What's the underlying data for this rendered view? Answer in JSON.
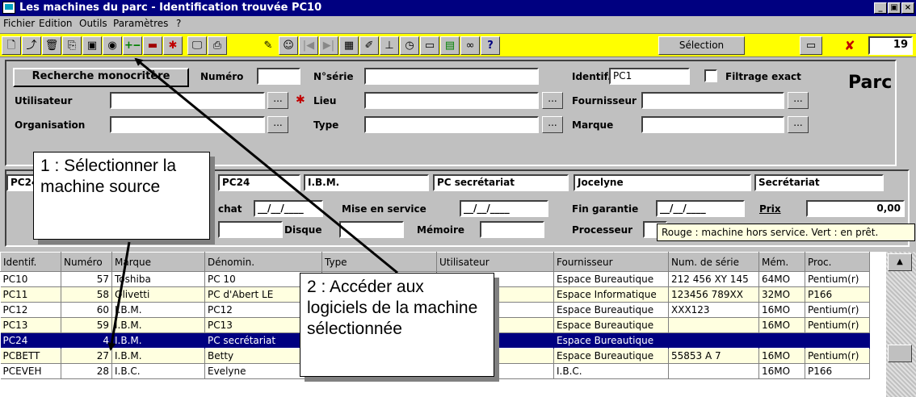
{
  "window": {
    "title": "Les machines du parc - Identification trouvée PC10",
    "controls": [
      "_",
      "ȸ",
      "×"
    ]
  },
  "menu": [
    "Fichier",
    "Edition",
    "Outils",
    "Paramètres",
    "?"
  ],
  "toolbar": {
    "selection_label": "Sélection",
    "count_value": "19"
  },
  "search": {
    "mode_button": "Recherche monocritère",
    "numero_label": "Numéro",
    "numero_value": "",
    "nserie_label": "N°série",
    "nserie_value": "",
    "identif_label": "Identif.",
    "identif_value": "PC1",
    "filtrage_label": "Filtrage exact",
    "utilisateur_label": "Utilisateur",
    "lieu_label": "Lieu",
    "fournisseur_label": "Fournisseur",
    "organisation_label": "Organisation",
    "type_label": "Type",
    "marque_label": "Marque",
    "dots": "...",
    "panel_title": "Parc"
  },
  "detail": {
    "identif_value": "PC24",
    "marque_value": "I.B.M.",
    "denomination_value": "PC secrétariat",
    "utilisateur_value": "Jocelyne",
    "organisation_value": "Secrétariat",
    "achat_label": "chat",
    "achat_value": "__/__/____",
    "mise_label": "Mise en service",
    "mise_value": "__/__/____",
    "fin_label": "Fin garantie",
    "fin_value": "__/__/____",
    "prix_label": "Prix",
    "prix_value": "0,00",
    "disque_label": "Disque",
    "memoire_label": "Mémoire",
    "processeur_label": "Processeur"
  },
  "tooltip": "Rouge : machine hors service. Vert : en prêt.",
  "grid": {
    "columns": [
      "Identif.",
      "Numéro",
      "Marque",
      "Dénomin.",
      "Type",
      "Utilisateur",
      "Fournisseur",
      "Num. de série",
      "Mém.",
      "Proc."
    ],
    "rows": [
      [
        "PC10",
        "57",
        "Toshiba",
        "PC 10",
        "",
        "ine",
        "Espace Bureautique",
        "212 456 XY 145",
        "64MO",
        "Pentium(r)"
      ],
      [
        "PC11",
        "58",
        "Olivetti",
        "PC d'Abert LE",
        "",
        "",
        "Espace Informatique",
        "123456 789XX",
        "32MO",
        "P166"
      ],
      [
        "PC12",
        "60",
        "I.B.M.",
        "PC12",
        "",
        "arie",
        "Espace Bureautique",
        "XXX123",
        "16MO",
        "Pentium(r)"
      ],
      [
        "PC13",
        "59",
        "I.B.M.",
        "PC13",
        "",
        "",
        "Espace Bureautique",
        "",
        "16MO",
        "Pentium(r)"
      ],
      [
        "PC24",
        "4",
        "I.B.M.",
        "PC secrétariat",
        "",
        "",
        "Espace Bureautique",
        "",
        "",
        ""
      ],
      [
        "PCBETT",
        "27",
        "I.B.M.",
        "Betty",
        "",
        "y",
        "Espace Bureautique",
        "55853 A 7",
        "16MO",
        "Pentium(r)"
      ],
      [
        "PCEVEH",
        "28",
        "I.B.C.",
        "Evelyne",
        "",
        "e",
        "I.B.C.",
        "",
        "16MO",
        "P166"
      ]
    ],
    "selected_index": 4
  },
  "callouts": {
    "step1": "1 : Sélectionner la machine source",
    "step2": "2 : Accéder aux logiciels de la machine sélectionnée"
  },
  "colors": {
    "titlebar": "#000080",
    "toolbar": "#ffff00",
    "selection": "#000080",
    "tooltip": "#ffffe1"
  }
}
